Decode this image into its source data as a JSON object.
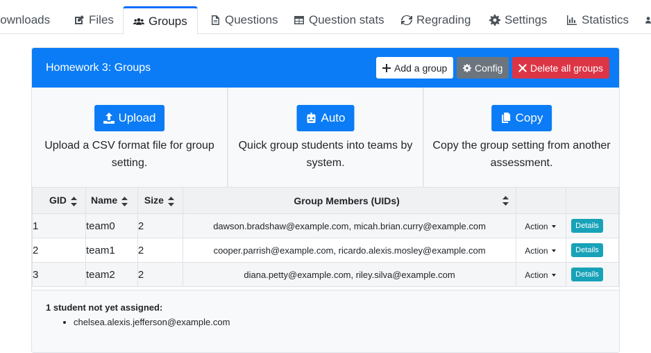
{
  "tabs": [
    {
      "label": "Downloads",
      "icon": "download-icon"
    },
    {
      "label": "Files",
      "icon": "edit-icon"
    },
    {
      "label": "Groups",
      "icon": "users-icon",
      "active": true
    },
    {
      "label": "Questions",
      "icon": "file-icon"
    },
    {
      "label": "Question stats",
      "icon": "table-icon"
    },
    {
      "label": "Regrading",
      "icon": "sync-icon"
    },
    {
      "label": "Settings",
      "icon": "gear-icon"
    },
    {
      "label": "Statistics",
      "icon": "chart-icon"
    }
  ],
  "header": {
    "title": "Homework 3: Groups",
    "add_label": "Add a group",
    "config_label": "Config",
    "delete_label": "Delete all groups"
  },
  "actions": {
    "upload": {
      "label": "Upload",
      "desc": "Upload a CSV format file for group setting."
    },
    "auto": {
      "label": "Auto",
      "desc": "Quick group students into teams by system."
    },
    "copy": {
      "label": "Copy",
      "desc": "Copy the group setting from another assessment."
    }
  },
  "table": {
    "headers": {
      "gid": "GID",
      "name": "Name",
      "size": "Size",
      "members": "Group Members (UIDs)"
    },
    "rows": [
      {
        "gid": "1",
        "name": "team0",
        "size": "2",
        "members": "dawson.bradshaw@example.com, micah.brian.curry@example.com",
        "action": "Action",
        "details": "Details"
      },
      {
        "gid": "2",
        "name": "team1",
        "size": "2",
        "members": "cooper.parrish@example.com, ricardo.alexis.mosley@example.com",
        "action": "Action",
        "details": "Details"
      },
      {
        "gid": "3",
        "name": "team2",
        "size": "2",
        "members": "diana.petty@example.com, riley.silva@example.com",
        "action": "Action",
        "details": "Details"
      }
    ]
  },
  "unassigned": {
    "title": "1 student not yet assigned:",
    "students": [
      "chelsea.alexis.jefferson@example.com"
    ]
  },
  "colors": {
    "primary": "#0b7cf5",
    "secondary": "#6c757d",
    "danger": "#dc3545",
    "info": "#17a2b8"
  }
}
